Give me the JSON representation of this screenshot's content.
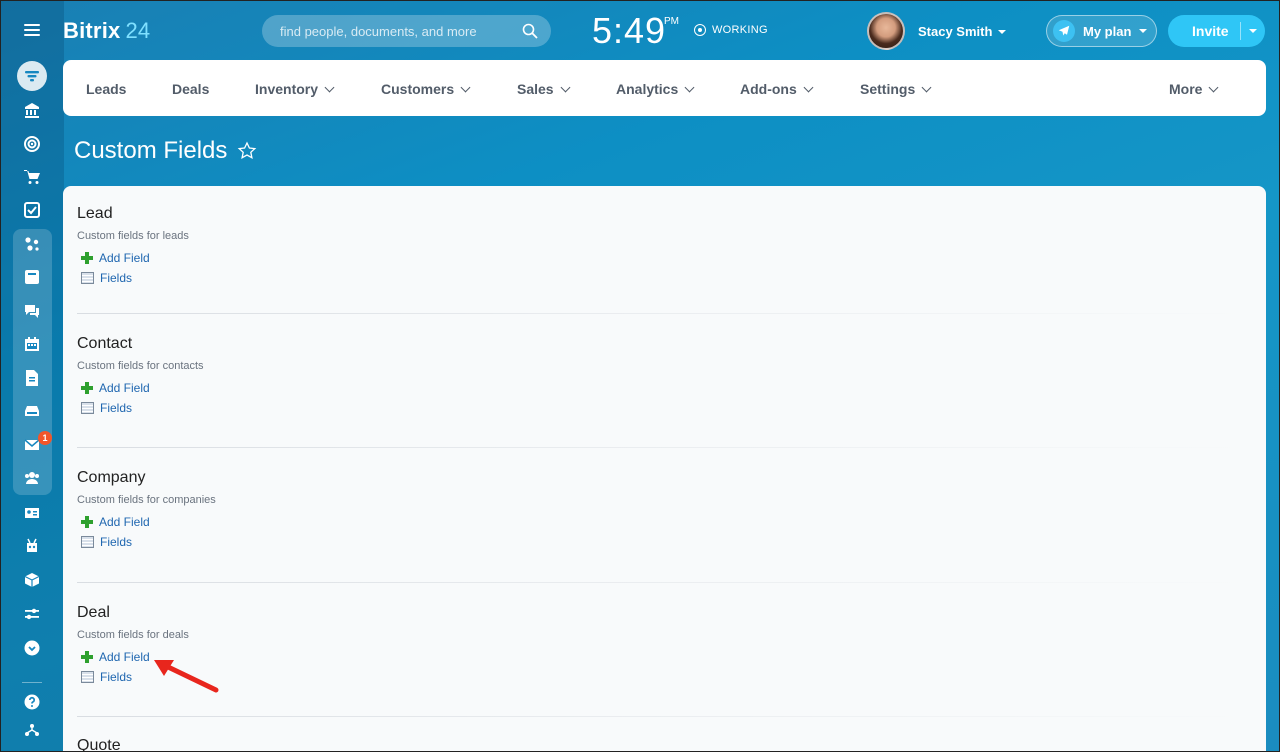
{
  "app": {
    "brand": "Bitrix",
    "brand_num": "24"
  },
  "search": {
    "placeholder": "find people, documents, and more"
  },
  "clock": {
    "time": "5:49",
    "ampm": "PM",
    "status": "WORKING"
  },
  "user": {
    "name": "Stacy Smith"
  },
  "plan": {
    "label": "My plan"
  },
  "invite": {
    "label": "Invite"
  },
  "menu": {
    "items": [
      {
        "label": "Leads"
      },
      {
        "label": "Deals"
      },
      {
        "label": "Inventory"
      },
      {
        "label": "Customers"
      },
      {
        "label": "Sales"
      },
      {
        "label": "Analytics"
      },
      {
        "label": "Add-ons"
      },
      {
        "label": "Settings"
      },
      {
        "label": "More"
      }
    ]
  },
  "page": {
    "title": "Custom Fields"
  },
  "sections": [
    {
      "title": "Lead",
      "desc": "Custom fields for leads",
      "add": "Add Field",
      "fields": "Fields"
    },
    {
      "title": "Contact",
      "desc": "Custom fields for contacts",
      "add": "Add Field",
      "fields": "Fields"
    },
    {
      "title": "Company",
      "desc": "Custom fields for companies",
      "add": "Add Field",
      "fields": "Fields"
    },
    {
      "title": "Deal",
      "desc": "Custom fields for deals",
      "add": "Add Field",
      "fields": "Fields"
    },
    {
      "title": "Quote"
    }
  ],
  "sidebar": {
    "mail_badge": "1"
  },
  "colors": {
    "accent": "#2fc6f6",
    "link": "#2067b0",
    "plus": "#2ea02e",
    "badge": "#f3562a",
    "arrow": "#e8261d"
  }
}
